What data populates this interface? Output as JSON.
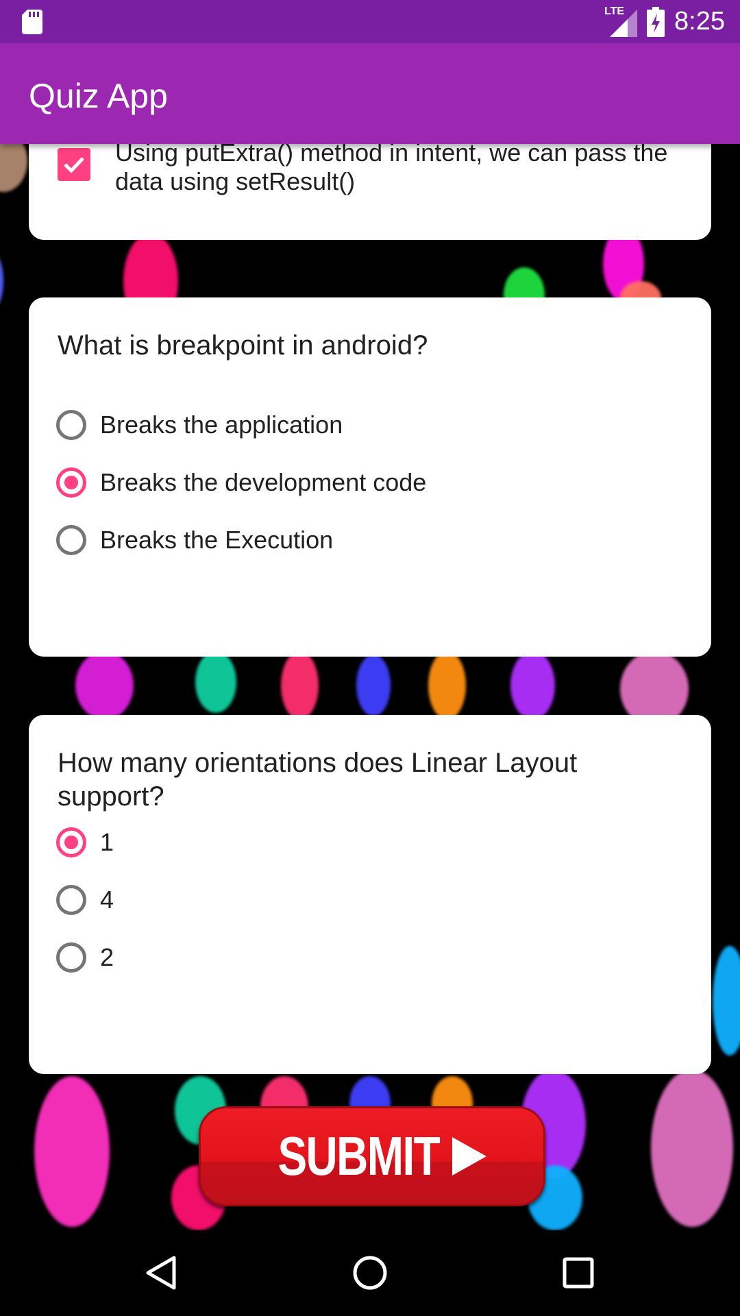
{
  "status_bar": {
    "time": "8:25",
    "network": "LTE",
    "icons": [
      "sd-card-icon",
      "signal-icon",
      "battery-charging-icon"
    ]
  },
  "app_bar": {
    "title": "Quiz App"
  },
  "card_previous": {
    "checkbox_label": "Using putExtra() method in intent, we can pass the data using setResult()",
    "checked": true
  },
  "question2": {
    "text": "What is breakpoint in android?",
    "options": [
      {
        "label": "Breaks the application",
        "selected": false
      },
      {
        "label": "Breaks the development code",
        "selected": true
      },
      {
        "label": "Breaks the Execution",
        "selected": false
      }
    ]
  },
  "question3": {
    "text": "How many orientations does Linear Layout support?",
    "options": [
      {
        "label": "1",
        "selected": true
      },
      {
        "label": "4",
        "selected": false
      },
      {
        "label": "2",
        "selected": false
      }
    ]
  },
  "submit": {
    "label": "SUBMIT"
  },
  "nav_bar": {
    "buttons": [
      "back-icon",
      "home-icon",
      "recents-icon"
    ]
  },
  "colors": {
    "status_bar": "#7B1FA2",
    "app_bar": "#9C27B0",
    "accent": "#FF4081",
    "submit_red": "#ED1C24"
  }
}
